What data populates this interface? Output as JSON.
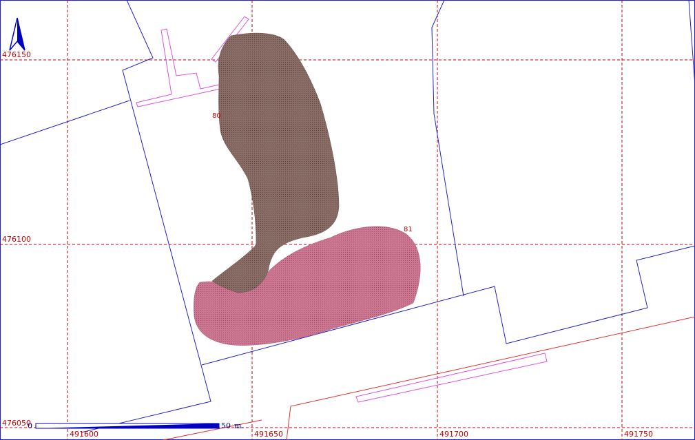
{
  "map": {
    "grid": {
      "x_labels": [
        "491600",
        "491650",
        "491700",
        "491750"
      ],
      "y_labels": [
        "476150",
        "476100",
        "476050"
      ]
    },
    "areas": [
      {
        "label": "80",
        "fill": "#7c5e57"
      },
      {
        "label": "81",
        "fill": "#c26a88"
      }
    ],
    "scale_bar": {
      "start": "0",
      "end": "50",
      "unit": "m."
    },
    "colors": {
      "grid": "#c00000",
      "parcel_boundary": "#2020c8",
      "building_outline": "#e050e0",
      "road_line": "#e03030",
      "north_arrow": "#0000c0"
    },
    "north_arrow": "north-arrow-icon"
  }
}
